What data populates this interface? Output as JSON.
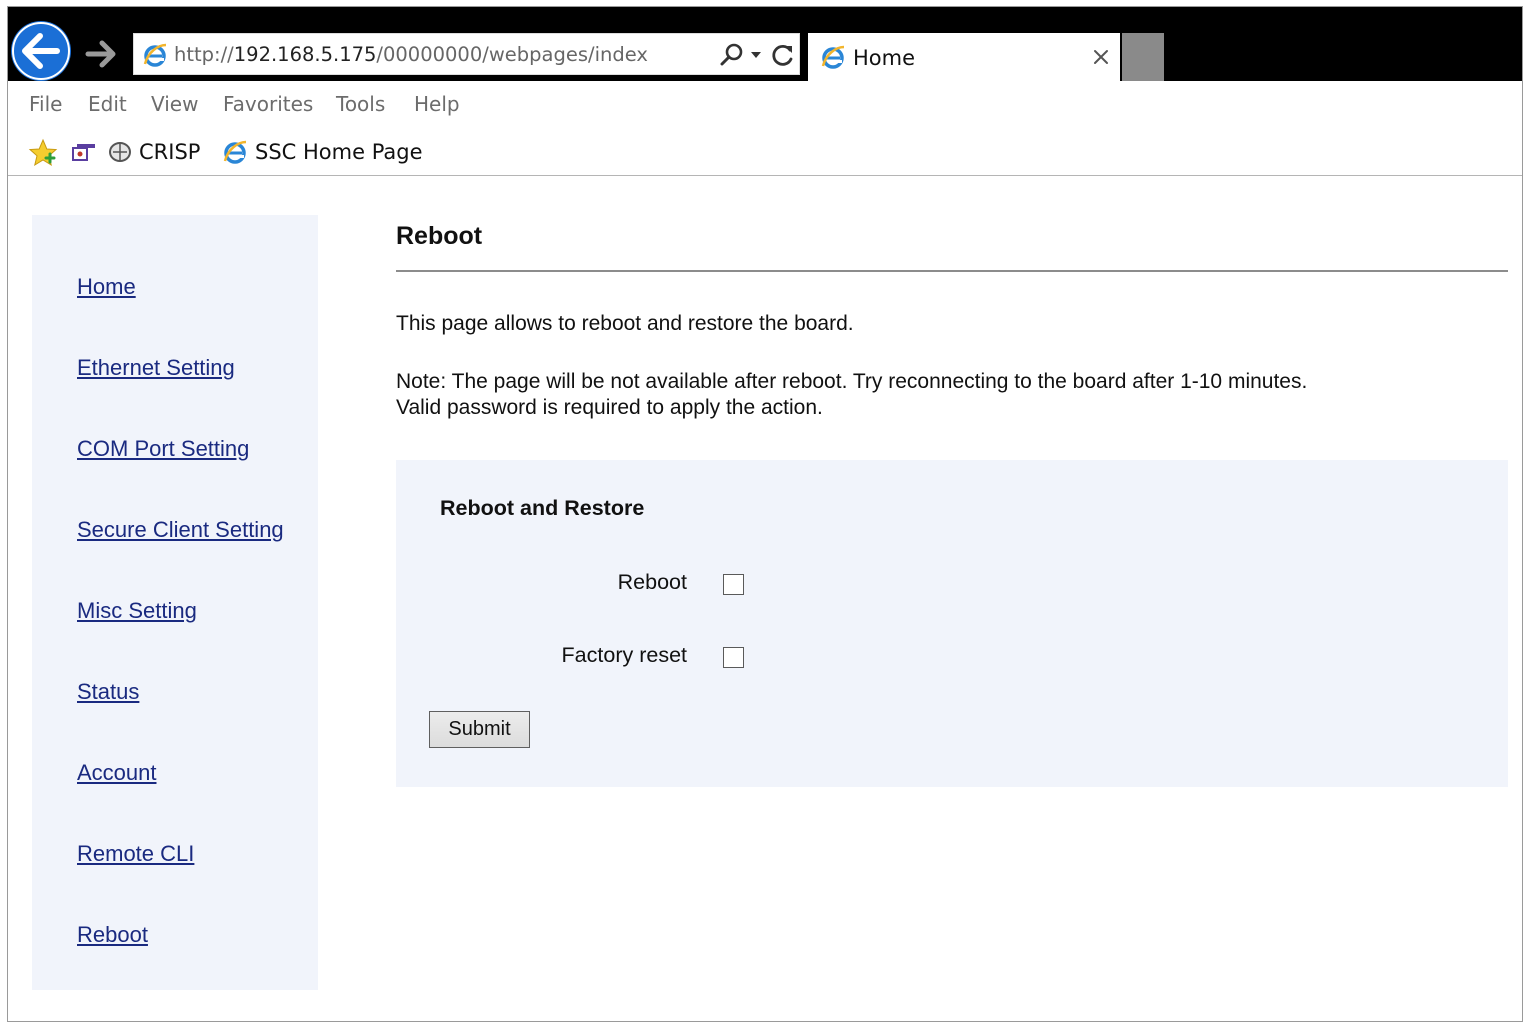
{
  "browser": {
    "address": {
      "url_prefix": "http://",
      "url_host": "192.168.5.175",
      "url_path": "/00000000/webpages/index"
    },
    "tab": {
      "title": "Home"
    },
    "menu": [
      "File",
      "Edit",
      "View",
      "Favorites",
      "Tools",
      "Help"
    ],
    "favorites": [
      {
        "label": "CRISP",
        "icon": "crisp-icon"
      },
      {
        "label": "SSC Home Page",
        "icon": "ie-icon"
      }
    ],
    "colors": {
      "titlebar": "#000000",
      "back_button": "#1b6fd6",
      "new_tab": "#8a8a8a"
    }
  },
  "sidebar": {
    "items": [
      {
        "label": "Home"
      },
      {
        "label": "Ethernet Setting"
      },
      {
        "label": "COM Port Setting"
      },
      {
        "label": "Secure Client Setting"
      },
      {
        "label": "Misc Setting"
      },
      {
        "label": "Status"
      },
      {
        "label": "Account"
      },
      {
        "label": "Remote CLI"
      },
      {
        "label": "Reboot"
      }
    ]
  },
  "main": {
    "title": "Reboot",
    "intro": "This page allows to reboot and restore the board.",
    "note_line1": "Note: The page will be not available after reboot. Try reconnecting to the board after 1-10 minutes.",
    "note_line2": "Valid password is required to apply the action.",
    "panel": {
      "title": "Reboot and Restore",
      "fields": [
        {
          "label": "Reboot",
          "checked": false
        },
        {
          "label": "Factory reset",
          "checked": false
        }
      ],
      "submit_label": "Submit"
    },
    "colors": {
      "panel_bg": "#f1f4fb",
      "link": "#1a2a80"
    }
  }
}
